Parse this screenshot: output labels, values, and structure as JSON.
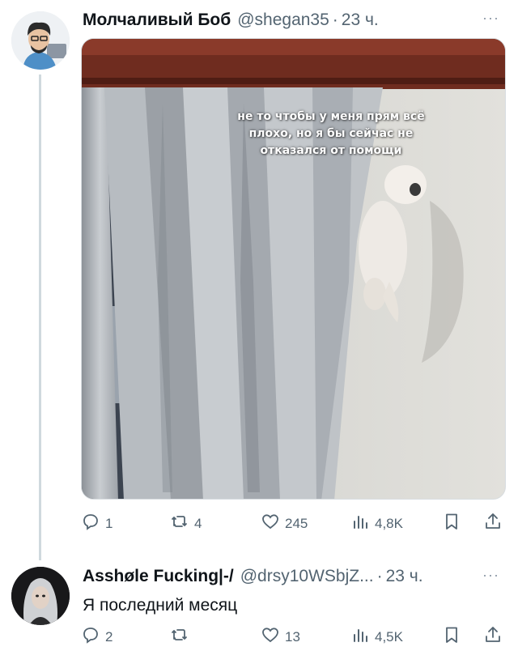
{
  "tweets": [
    {
      "display_name": "Молчаливый Боб",
      "handle": "@shegan35",
      "separator": "·",
      "time": "23 ч.",
      "more": "···",
      "image_caption": "не то чтобы у меня прям всё плохо, но я бы сейчас не отказался от помощи",
      "stats": {
        "replies": "1",
        "retweets": "4",
        "likes": "245",
        "views": "4,8K"
      }
    },
    {
      "display_name": "Asshøle Fucking|-/",
      "handle": "@drsy10WSbjZ...",
      "separator": "·",
      "time": "23 ч.",
      "more": "···",
      "text": "Я последний месяц",
      "stats": {
        "replies": "2",
        "retweets": "",
        "likes": "13",
        "views": "4,5K"
      }
    }
  ],
  "icons": {
    "reply": "reply-icon",
    "retweet": "retweet-icon",
    "like": "heart-icon",
    "views": "bar-chart-icon",
    "bookmark": "bookmark-icon",
    "share": "share-icon"
  },
  "colors": {
    "text": "#0f1419",
    "secondary": "#536471",
    "thread_line": "#cfd9de"
  }
}
